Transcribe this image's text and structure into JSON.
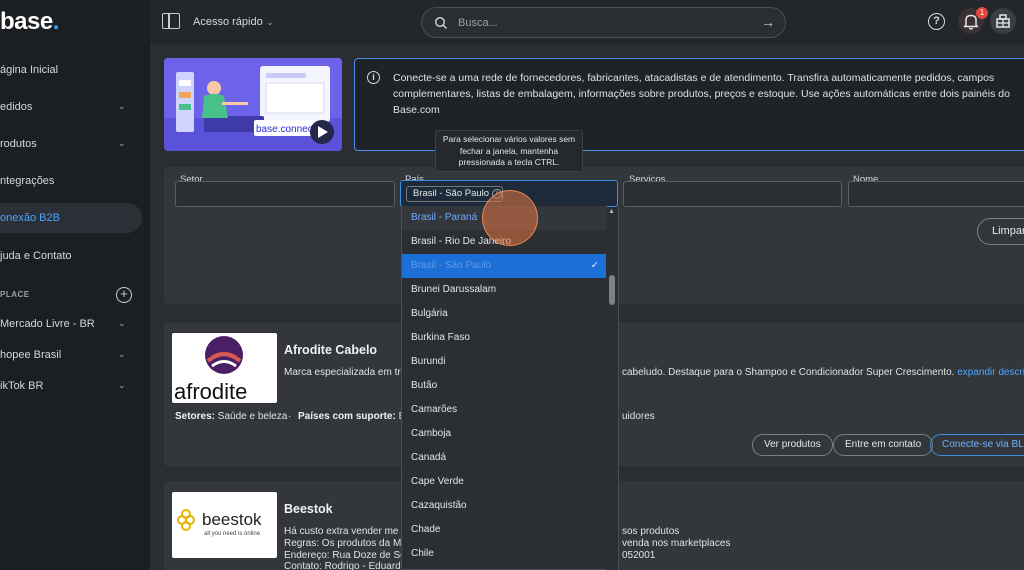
{
  "app": {
    "logo": "base",
    "logo_dot": "."
  },
  "sidebar": {
    "items": [
      {
        "label": "ágina Inicial",
        "chevron": false
      },
      {
        "label": "edidos",
        "chevron": true
      },
      {
        "label": "rodutos",
        "chevron": true
      },
      {
        "label": "ntegrações",
        "chevron": false
      },
      {
        "label": "onexão B2B",
        "chevron": false,
        "active": true
      },
      {
        "label": "juda e Contato",
        "chevron": false
      }
    ],
    "section_label": "PLACE",
    "marketplaces": [
      {
        "label": "Mercado Livre - BR"
      },
      {
        "label": "hopee Brasil"
      },
      {
        "label": "ikTok BR"
      }
    ]
  },
  "topbar": {
    "quick_access": "Acesso rápido",
    "search_placeholder": "Busca...",
    "notification_count": "1"
  },
  "banner": {
    "text": "Conecte-se a uma rede de fornecedores, fabricantes, atacadistas e de atendimento. Transfira automaticamente pedidos, campos complementares, listas de embalagem, informações sobre produtos, preços e estoque. Use ações automáticas entre dois painéis do Base.com",
    "image_caption": "base.connect"
  },
  "filters": {
    "setor_label": "Setor",
    "pais_label": "País",
    "servicos_label": "Serviços",
    "nome_label": "Nome",
    "selected_chip": "Brasil - São Paulo",
    "clear_button": "Limpar",
    "tooltip": "Para selecionar vários valores sem fechar a janela, mantenha pressionada a tecla CTRL."
  },
  "country_options": [
    {
      "label": "Brasil - Paraná",
      "state": "dim"
    },
    {
      "label": "Brasil - Rio De Janeiro",
      "state": ""
    },
    {
      "label": "Brasil - São Paulo",
      "state": "sel"
    },
    {
      "label": "Brunei Darussalam",
      "state": ""
    },
    {
      "label": "Bulgária",
      "state": ""
    },
    {
      "label": "Burkina Faso",
      "state": ""
    },
    {
      "label": "Burundi",
      "state": ""
    },
    {
      "label": "Butão",
      "state": ""
    },
    {
      "label": "Camarões",
      "state": ""
    },
    {
      "label": "Camboja",
      "state": ""
    },
    {
      "label": "Canadá",
      "state": ""
    },
    {
      "label": "Cape Verde",
      "state": ""
    },
    {
      "label": "Cazaquistão",
      "state": ""
    },
    {
      "label": "Chade",
      "state": ""
    },
    {
      "label": "Chile",
      "state": ""
    }
  ],
  "suppliers": [
    {
      "name": "Afrodite Cabelo",
      "logo_text": "afrodite",
      "desc_left": "Marca especializada em tr",
      "desc_right": "cabeludo. Destaque para o Shampoo e Condicionador Super Crescimento.",
      "expand": "expandir descrição",
      "sectors_label": "Setores:",
      "sectors_value": "Saúde e beleza",
      "countries_label": "Países com suporte:",
      "countries_value": "B",
      "tail": "uidores",
      "btn_products": "Ver produtos",
      "btn_contact": "Entre em contato",
      "btn_connect": "Conecte-se via BL Co"
    },
    {
      "name": "Beestok",
      "logo_text": "beestok",
      "logo_tagline": "all you need is online",
      "lines_left": [
        "Há custo extra vender me",
        "Regras: Os produtos da M",
        "Endereço: Rua Doze de Se",
        "Contato: Rodrigo - Eduard"
      ],
      "lines_right": [
        "sos produtos",
        "venda nos marketplaces",
        "052001"
      ]
    }
  ],
  "colors": {
    "accent": "#3d8ee0",
    "sidebar_bg": "#1c1f22",
    "badge": "#e0463c"
  }
}
